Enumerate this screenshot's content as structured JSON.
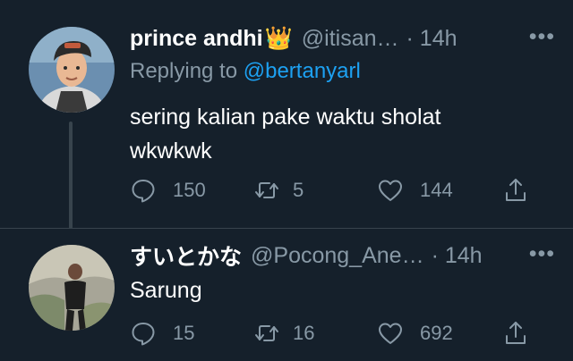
{
  "tweets": [
    {
      "name": "prince andhi",
      "badge": "👑",
      "handle": "@itisan…",
      "time": "· 14h",
      "more": "•••",
      "reply_prefix": "Replying to ",
      "reply_to": "@bertanyarl",
      "text_line1": "sering kalian pake waktu sholat",
      "text_line2": "wkwkwk",
      "replies": "150",
      "retweets": "5",
      "likes": "144"
    },
    {
      "name": "すいとかな",
      "handle": "@Pocong_Ane…",
      "time": "· 14h",
      "more": "•••",
      "text_line1": "Sarung",
      "replies": "15",
      "retweets": "16",
      "likes": "692"
    }
  ],
  "colors": {
    "background": "#15202b",
    "secondary_text": "#8899a6",
    "link": "#1da1f2",
    "divider": "#38444d"
  }
}
